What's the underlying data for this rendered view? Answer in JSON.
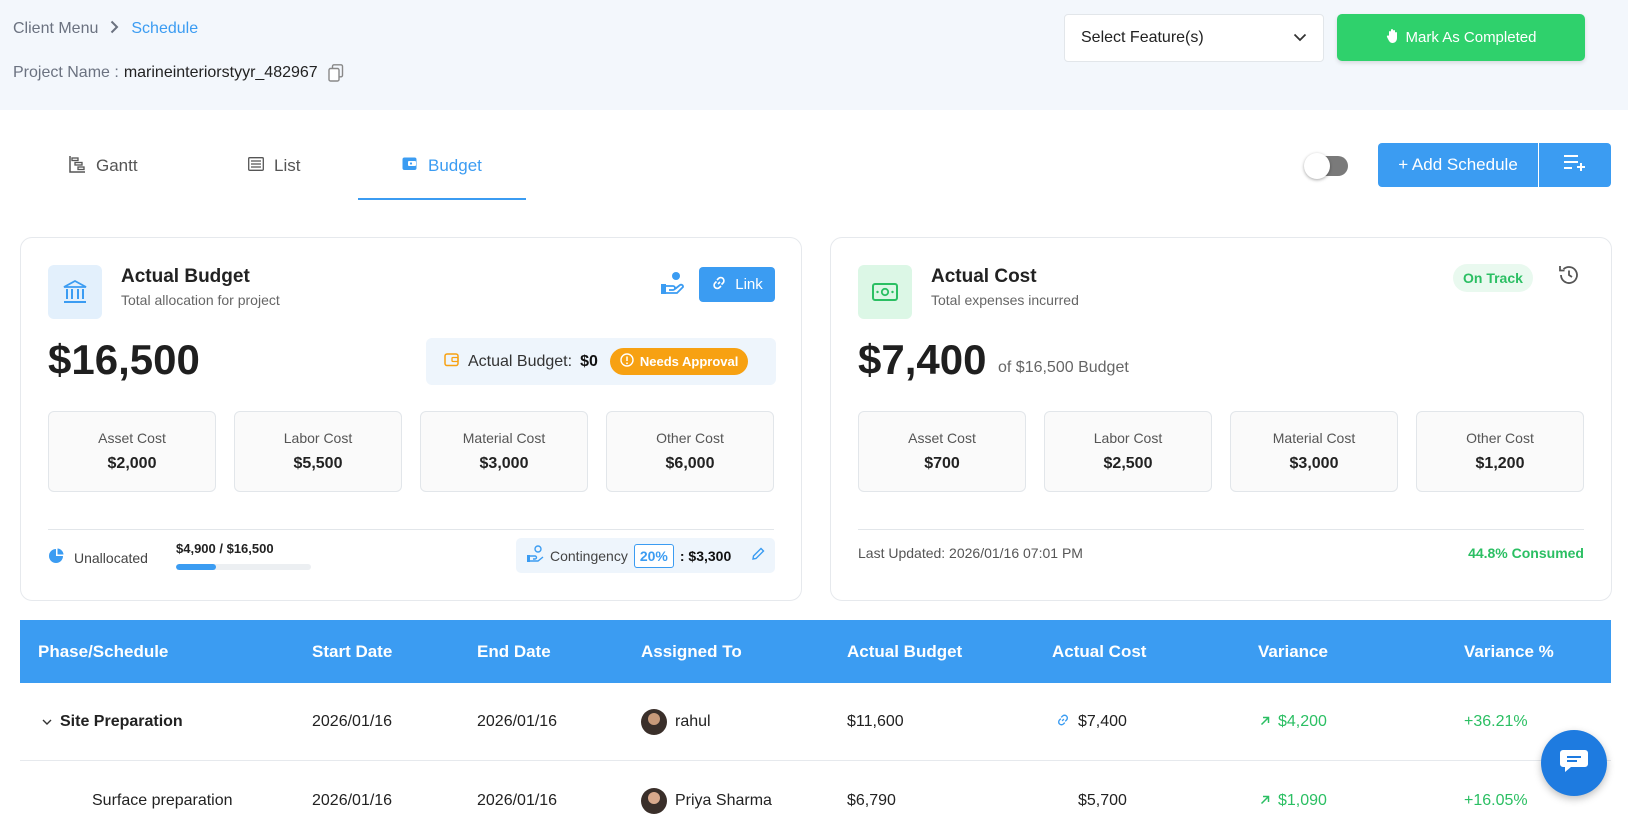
{
  "breadcrumb": {
    "parent": "Client Menu",
    "current": "Schedule"
  },
  "project": {
    "label": "Project Name :",
    "name": "marineinteriorstyyr_482967"
  },
  "feature_select": {
    "value": "Select Feature(s)"
  },
  "mark_completed": {
    "label": "Mark As Completed"
  },
  "tabs": [
    {
      "label": "Gantt",
      "icon": "gantt-icon"
    },
    {
      "label": "List",
      "icon": "list-icon"
    },
    {
      "label": "Budget",
      "icon": "wallet-icon",
      "active": true
    }
  ],
  "toggle": {
    "on": false
  },
  "add_schedule": {
    "label": "+ Add Schedule"
  },
  "budget_card": {
    "title": "Actual Budget",
    "subtitle": "Total allocation for project",
    "amount": "$16,500",
    "link_label": "Link",
    "approval_label": "Actual Budget:",
    "approval_value": "$0",
    "needs_approval": "Needs Approval",
    "costs": [
      {
        "label": "Asset Cost",
        "value": "$2,000"
      },
      {
        "label": "Labor Cost",
        "value": "$5,500"
      },
      {
        "label": "Material Cost",
        "value": "$3,000"
      },
      {
        "label": "Other Cost",
        "value": "$6,000"
      }
    ],
    "unallocated_label": "Unallocated",
    "unallocated_value": "$4,900 / $16,500",
    "unallocated_fraction": 0.297,
    "contingency_label": "Contingency",
    "contingency_pct": "20%",
    "contingency_amount": ": $3,300"
  },
  "cost_card": {
    "title": "Actual Cost",
    "subtitle": "Total expenses incurred",
    "amount": "$7,400",
    "of_budget": "of $16,500 Budget",
    "status": "On Track",
    "costs": [
      {
        "label": "Asset Cost",
        "value": "$700"
      },
      {
        "label": "Labor Cost",
        "value": "$2,500"
      },
      {
        "label": "Material Cost",
        "value": "$3,000"
      },
      {
        "label": "Other Cost",
        "value": "$1,200"
      }
    ],
    "last_updated": "Last Updated: 2026/01/16 07:01 PM",
    "consumed": "44.8% Consumed"
  },
  "table": {
    "headers": [
      "Phase/Schedule",
      "Start Date",
      "End Date",
      "Assigned To",
      "Actual Budget",
      "Actual Cost",
      "Variance",
      "Variance %"
    ],
    "rows": [
      {
        "name": "Site Preparation",
        "start": "2026/01/16",
        "end": "2026/01/16",
        "assignee": "rahul",
        "budget": "$11,600",
        "cost": "$7,400",
        "variance": "$4,200",
        "variance_pct": "+36.21%"
      },
      {
        "name": "Surface preparation",
        "start": "2026/01/16",
        "end": "2026/01/16",
        "assignee": "Priya Sharma",
        "budget": "$6,790",
        "cost": "$5,700",
        "variance": "$1,090",
        "variance_pct": "+16.05%"
      }
    ]
  },
  "colors": {
    "primary": "#3b9cf2",
    "success": "#2fd16c",
    "warning": "#f7a112"
  }
}
